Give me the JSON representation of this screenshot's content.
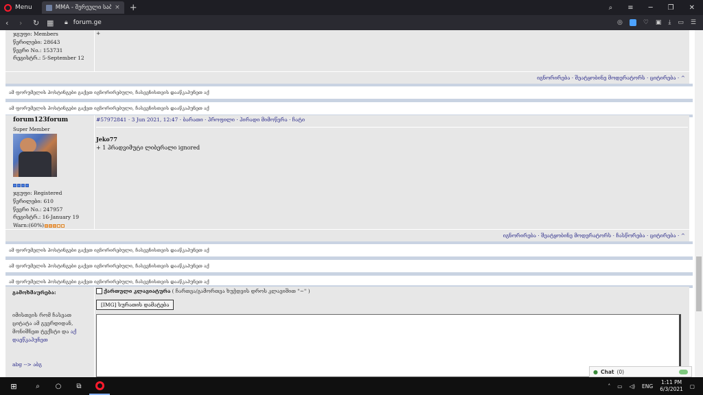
{
  "browser": {
    "menu_label": "Menu",
    "tab_title": "MMA - შერეული საბრძო",
    "tab_close": "×",
    "new_tab": "+",
    "url": "forum.ge",
    "icons": [
      "back-icon",
      "forward-icon",
      "reload-icon",
      "speed-dial-icon",
      "lock-icon",
      "camera-icon",
      "vpn-shield-icon",
      "heart-icon",
      "wallet-icon",
      "download-icon",
      "battery-icon",
      "settings-icon"
    ],
    "window_controls": [
      "search-icon",
      "minimize-icon",
      "restore-icon",
      "close-icon"
    ]
  },
  "post1": {
    "plus": "+",
    "meta": [
      "ჯგუფი: Members",
      "წერილები: 28643",
      "წევრი No.: 153731",
      "რეგისტრ.: 5-September 12"
    ],
    "controls": "იგნორირება · შეატყობინე მოდერატორს · ციტირება · ^"
  },
  "ignored_notice": "ამ ფორუმელის პოსტინგები გაქვთ იგნორირებული, ჩასვენისთვის დააწკაპუნეთ აქ",
  "post2": {
    "username": "forum123forum",
    "rank": "Super Member",
    "meta": [
      "ჯგუფი: Registered",
      "წერილები: 610",
      "წევრი No.: 247957",
      "რეგისტრ.: 16-January 19"
    ],
    "warn": "Warn:(60%)",
    "header": "#57972841 · 3 Jun 2021, 12:47 · ბარათი · პროფილი · პირადი მიმოწერა · ჩატი",
    "quote_author": "Jeko77",
    "body": "+ 1 პრადვიმუტი ლიბერალი ignored",
    "controls": "იგნორირება · შეატყობინე მოდერატორს · ჩასწორება · ციტირება · ^"
  },
  "reply": {
    "label": "გამოხმაურება:",
    "hint_text": "იმისთვის რომ ჩასვათ ციტატა ამ გვერდიდან, მონიშნეთ ტექსტი და",
    "hint_link": "აქ დაეწკაპუნეთ",
    "abg": "abg --> აბგ",
    "keyboard_label": "ქართული კლავიატურა",
    "keyboard_note": "( ჩართვა/გამორთვა ხუჭდვის დროს კლავიშით \"~\" )",
    "img_button": "[IMG] სურათის დამატება"
  },
  "chat": {
    "label": "Chat",
    "count": "(0)"
  },
  "taskbar": {
    "lang": "ENG",
    "time": "1:11 PM",
    "date": "6/3/2021"
  }
}
